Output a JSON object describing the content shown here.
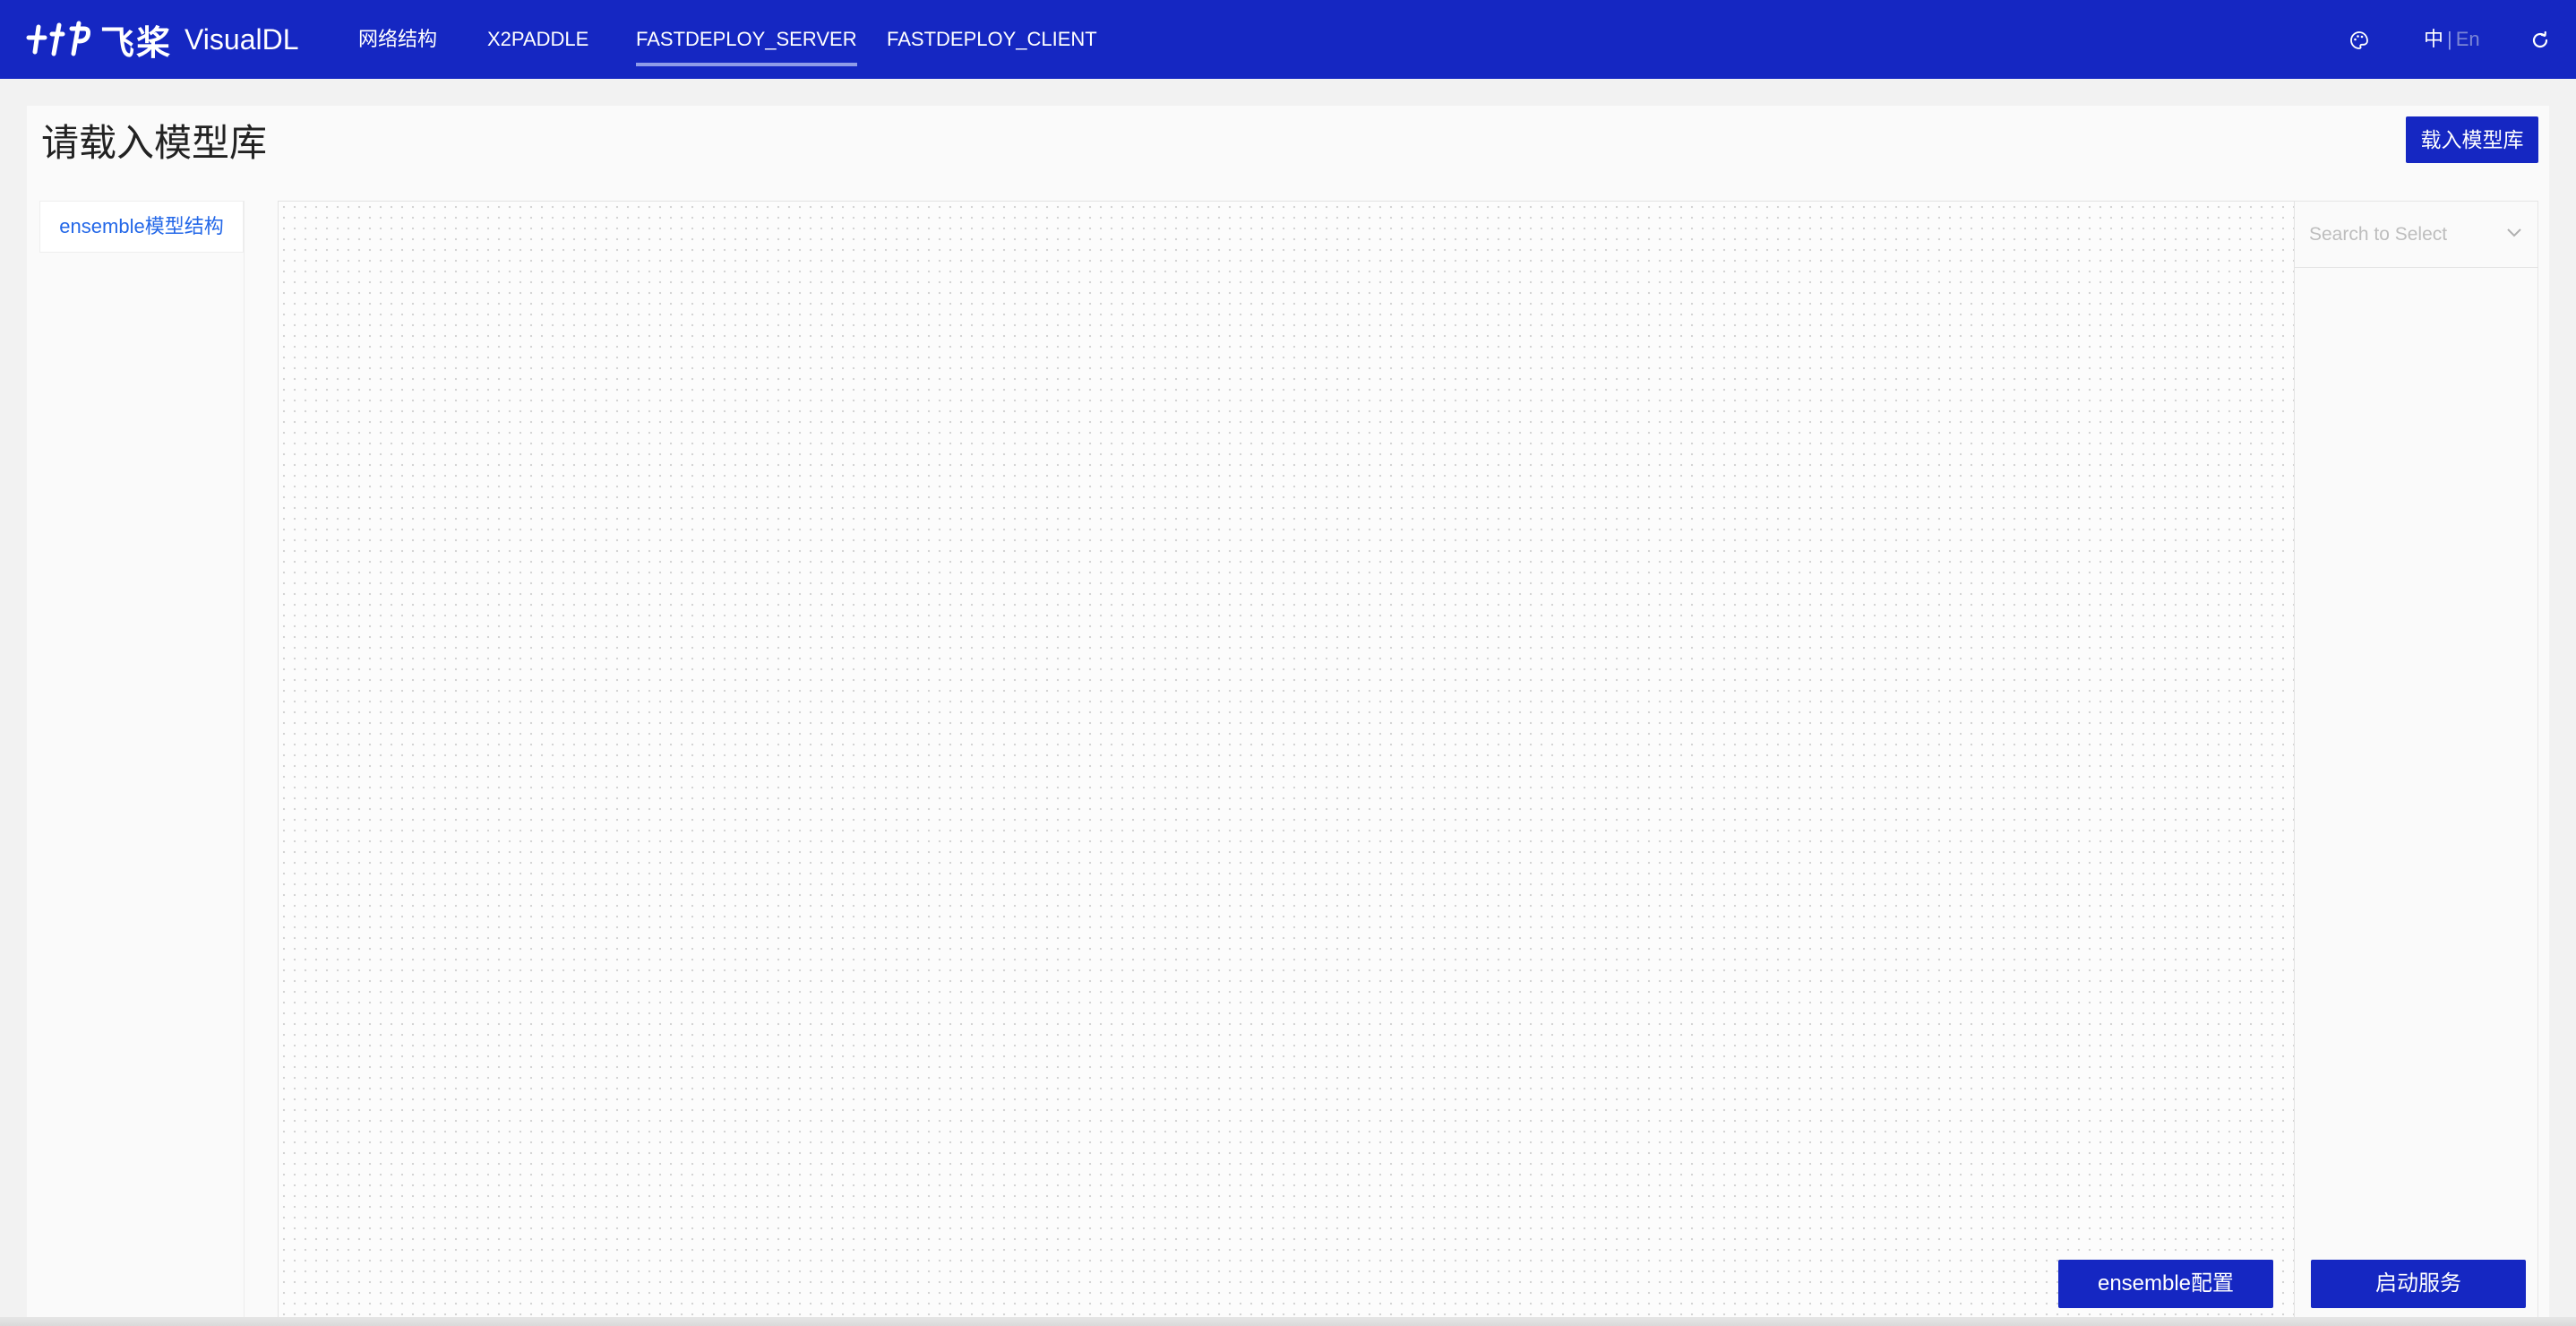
{
  "header": {
    "brand_cn": "飞桨",
    "brand_en": "VisualDL",
    "nav": [
      {
        "label": "网络结构"
      },
      {
        "label": "X2PADDLE"
      },
      {
        "label": "FASTDEPLOY_SERVER"
      },
      {
        "label": "FASTDEPLOY_CLIENT"
      }
    ],
    "lang_zh": "中",
    "lang_sep": "|",
    "lang_en": "En",
    "icons": [
      "palette-icon",
      "refresh-icon"
    ]
  },
  "page": {
    "title": "请载入模型库",
    "load_button": "载入模型库"
  },
  "sidebar": {
    "items": [
      {
        "label": "ensemble模型结构"
      }
    ]
  },
  "panel": {
    "select_placeholder": "Search to Select",
    "ensemble_config_button": "ensemble配置",
    "start_service_button": "启动服务"
  },
  "colors": {
    "nav_bg": "#1527c2",
    "accent_text": "#2468e8"
  }
}
